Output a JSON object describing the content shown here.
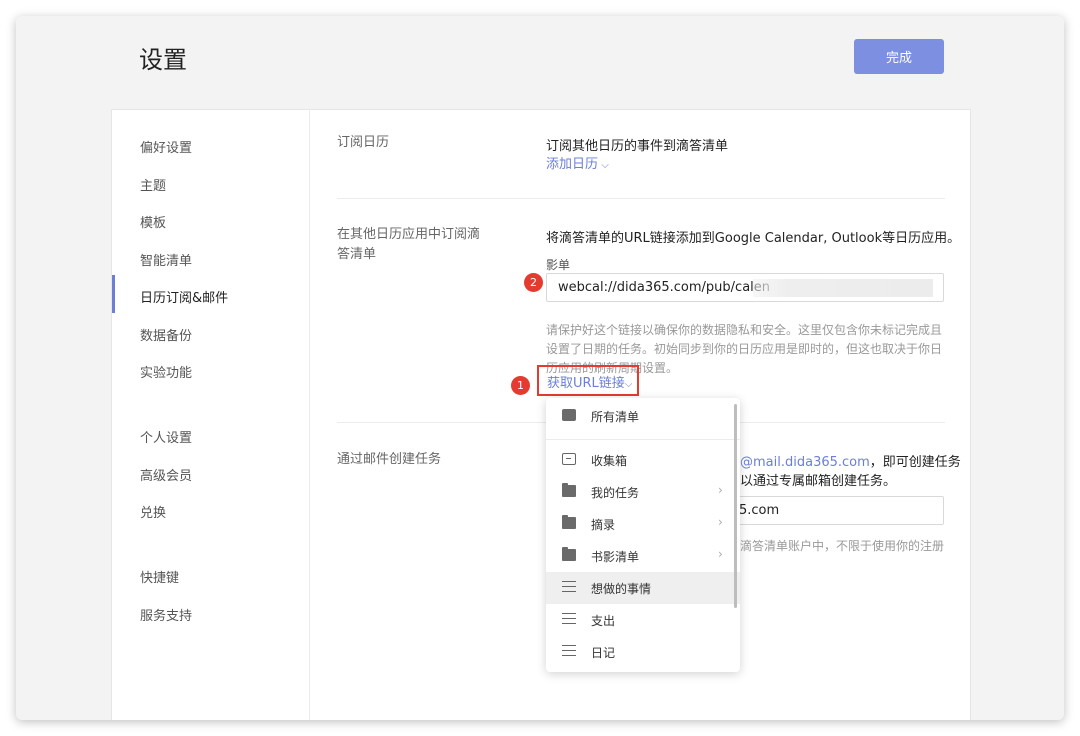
{
  "header": {
    "title": "设置",
    "done_label": "完成"
  },
  "sidebar": {
    "items": [
      {
        "label": "偏好设置"
      },
      {
        "label": "主题"
      },
      {
        "label": "模板"
      },
      {
        "label": "智能清单"
      },
      {
        "label": "日历订阅&邮件",
        "active": true
      },
      {
        "label": "数据备份"
      },
      {
        "label": "实验功能"
      },
      {
        "label": "个人设置"
      },
      {
        "label": "高级会员"
      },
      {
        "label": "兑换"
      },
      {
        "label": "快捷键"
      },
      {
        "label": "服务支持"
      }
    ]
  },
  "subscribe": {
    "label": "订阅日历",
    "desc": "订阅其他日历的事件到滴答清单",
    "link": "添加日历"
  },
  "export": {
    "label": "在其他日历应用中订阅滴答清单",
    "desc": "将滴答清单的URL链接添加到Google Calendar, Outlook等日历应用。",
    "field_label": "影单",
    "url_value": "webcal://dida365.com/pub/calen",
    "hint": "请保护好这个链接以确保你的数据隐私和安全。这里仅包含你未标记完成且设置了日期的任务。初始同步到你的日历应用是即时的，但这也取决于你日历应用的刷新周期设置。",
    "get_url_link": "获取URL链接"
  },
  "email": {
    "label": "通过邮件创建任务",
    "addr_suffix": "@mail.dida365.com",
    "desc_line1_end": "，即可创建任务",
    "desc_line2": "以通过专属邮箱创建任务。",
    "input_value": "5.com",
    "hint": "滴答清单账户中，不限于使用你的注册"
  },
  "badges": {
    "one": "1",
    "two": "2"
  },
  "dropdown": {
    "items": [
      {
        "label": "所有清单",
        "icon": "stack-icon"
      },
      {
        "label": "收集箱",
        "icon": "inbox-icon"
      },
      {
        "label": "我的任务",
        "icon": "folder-icon",
        "chevron": "›"
      },
      {
        "label": "摘录",
        "icon": "folder-icon",
        "chevron": "›"
      },
      {
        "label": "书影清单",
        "icon": "folder-icon",
        "chevron": "›"
      },
      {
        "label": "想做的事情",
        "icon": "list-icon",
        "highlighted": true
      },
      {
        "label": "支出",
        "icon": "list-icon"
      },
      {
        "label": "日记",
        "icon": "list-icon"
      }
    ]
  },
  "colors": {
    "accent": "#7d8fe0",
    "link": "#6b7fd7",
    "annotation": "#e53a2f"
  }
}
